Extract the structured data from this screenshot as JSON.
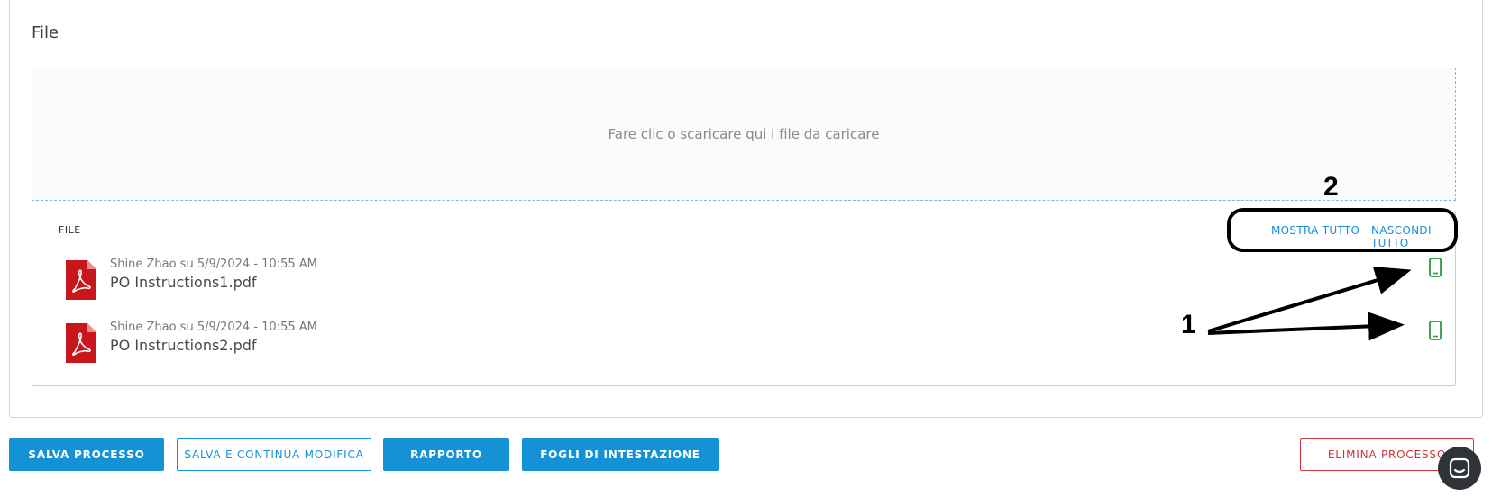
{
  "section": {
    "title": "File"
  },
  "dropzone": {
    "text": "Fare clic o scaricare qui i file da caricare"
  },
  "files": {
    "header_label": "FILE",
    "show_all": "MOSTRA TUTTO",
    "hide_all": "NASCONDI TUTTO",
    "items": [
      {
        "meta": "Shine Zhao su 5/9/2024 - 10:55 AM",
        "name": "PO Instructions1.pdf",
        "icon": "pdf-icon",
        "status_icon": "mobile-icon"
      },
      {
        "meta": "Shine Zhao su 5/9/2024 - 10:55 AM",
        "name": "PO Instructions2.pdf",
        "icon": "pdf-icon",
        "status_icon": "mobile-icon"
      }
    ]
  },
  "annotations": {
    "label_1": "1",
    "label_2": "2"
  },
  "actions": {
    "save_process": "SALVA PROCESSO",
    "save_continue": "SALVA E CONTINUA MODIFICA",
    "report": "RAPPORTO",
    "letterheads": "FOGLI DI INTESTAZIONE",
    "delete_process": "ELIMINA PROCESSO"
  },
  "colors": {
    "accent": "#1592d5",
    "danger": "#d13438",
    "pdf": "#c8161d",
    "mobile": "#2e9b3a"
  }
}
